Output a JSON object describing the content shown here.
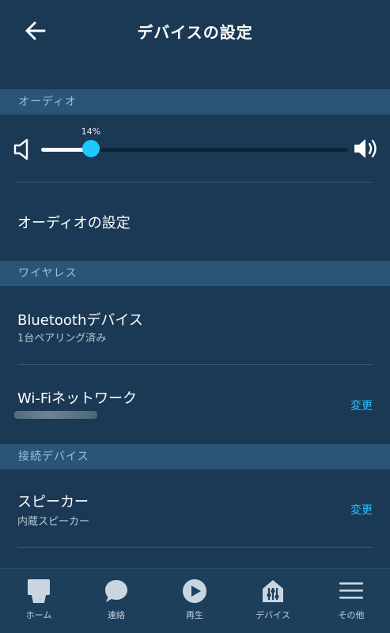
{
  "header": {
    "title": "デバイスの設定"
  },
  "audio_section": {
    "header": "オーディオ",
    "volume_percent_label": "14%",
    "volume_level": 0.14,
    "audio_settings_label": "オーディオの設定"
  },
  "wireless_section": {
    "header": "ワイヤレス",
    "bluetooth": {
      "title": "Bluetoothデバイス",
      "subtitle": "1台ペアリング済み"
    },
    "wifi": {
      "title": "Wi-Fiネットワーク",
      "change_label": "変更"
    }
  },
  "connected_section": {
    "header": "接続デバイス",
    "speaker": {
      "title": "スピーカー",
      "subtitle": "内蔵スピーカー",
      "change_label": "変更"
    }
  },
  "bottom_nav": {
    "items": [
      {
        "label": "ホーム",
        "icon": "home-icon"
      },
      {
        "label": "連絡",
        "icon": "chat-bubble-icon"
      },
      {
        "label": "再生",
        "icon": "play-icon"
      },
      {
        "label": "デバイス",
        "icon": "devices-icon"
      },
      {
        "label": "その他",
        "icon": "menu-icon"
      }
    ]
  },
  "colors": {
    "background": "#1b3954",
    "section_header": "#2a5576",
    "accent": "#24c4ff",
    "slider_thumb": "#1ec8ff"
  }
}
